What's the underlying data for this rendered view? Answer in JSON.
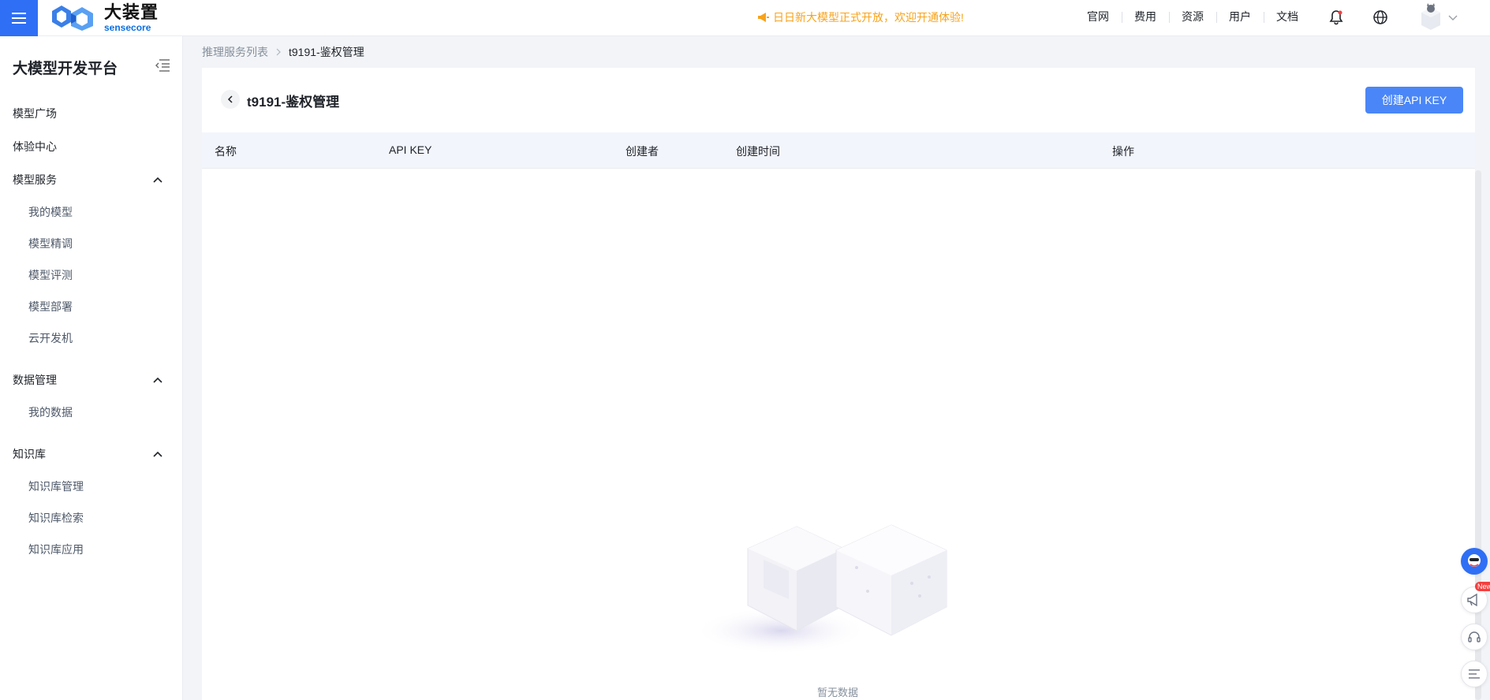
{
  "header": {
    "logo_cn": "大装置",
    "logo_en": "sensecore",
    "announcement": "日日新大模型正式开放，欢迎开通体验!",
    "nav": [
      "官网",
      "费用",
      "资源",
      "用户",
      "文档"
    ],
    "accent": "#2f6ff5",
    "announcement_color": "#f7a31b"
  },
  "sidebar": {
    "title": "大模型开发平台",
    "items": [
      {
        "label": "模型广场"
      },
      {
        "label": "体验中心"
      }
    ],
    "groups": [
      {
        "label": "模型服务",
        "children": [
          "我的模型",
          "模型精调",
          "模型评测",
          "模型部署",
          "云开发机"
        ]
      },
      {
        "label": "数据管理",
        "children": [
          "我的数据"
        ]
      },
      {
        "label": "知识库",
        "children": [
          "知识库管理",
          "知识库检索",
          "知识库应用"
        ]
      }
    ]
  },
  "breadcrumb": {
    "parent": "推理服务列表",
    "current": "t9191-鉴权管理"
  },
  "main": {
    "title": "t9191-鉴权管理",
    "create_button": "创建API KEY",
    "columns": [
      "名称",
      "API KEY",
      "创建者",
      "创建时间",
      "操作"
    ],
    "empty_text": "暂无数据"
  },
  "floating": {
    "new_badge": "New"
  }
}
